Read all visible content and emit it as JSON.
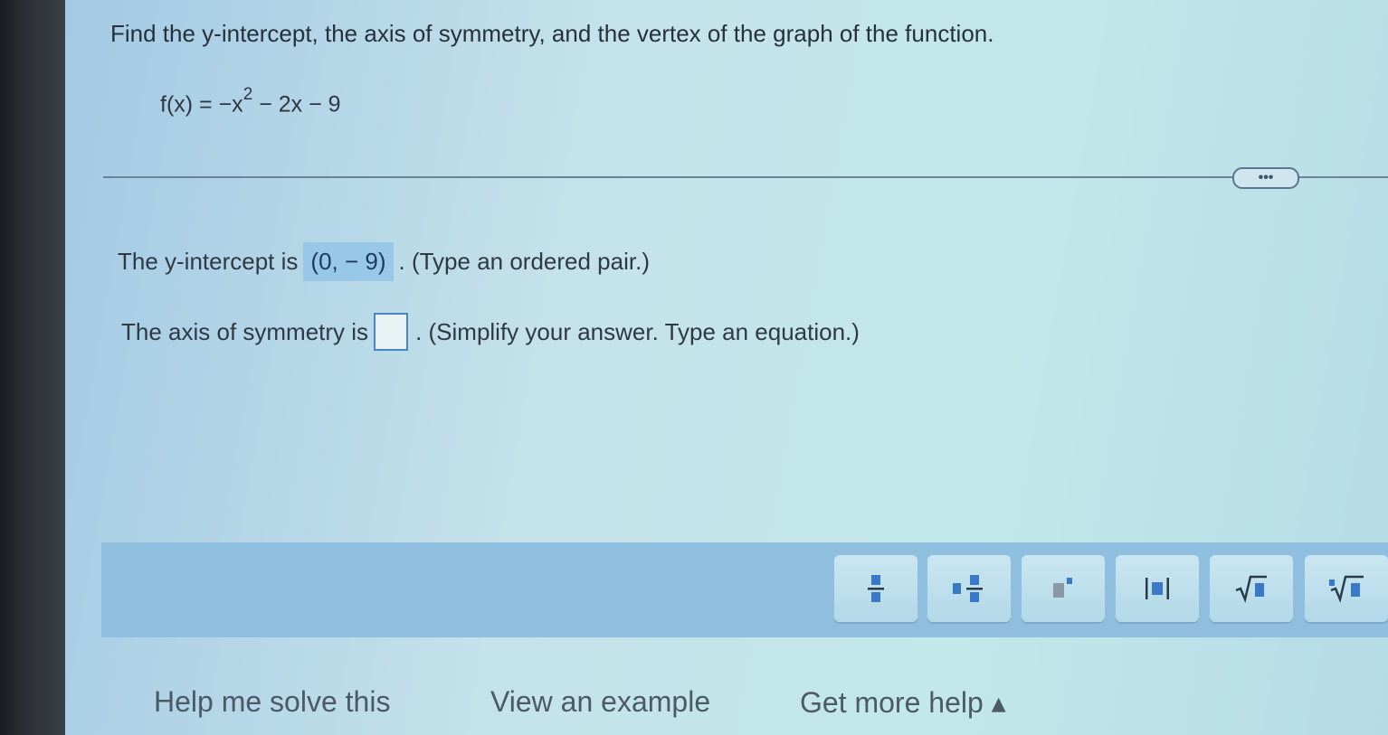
{
  "question": {
    "prompt": "Find the y-intercept, the axis of symmetry, and the vertex of the graph of the function.",
    "function_lhs": "f(x) = −x",
    "function_exp": "2",
    "function_rhs": " − 2x − 9"
  },
  "more_button": {
    "label": "•••"
  },
  "y_intercept": {
    "prefix": "The y-intercept is",
    "answer": "(0, − 9)",
    "suffix": ". (Type an ordered pair.)"
  },
  "axis_symmetry": {
    "prefix": "The axis of symmetry is",
    "value": "",
    "suffix": ". (Simplify your answer. Type an equation.)"
  },
  "toolbar": {
    "tools": [
      "fraction-icon",
      "mixed-number-icon",
      "exponent-icon",
      "absolute-value-icon",
      "square-root-icon",
      "nth-root-icon"
    ]
  },
  "help_links": {
    "solve": "Help me solve this",
    "example": "View an example",
    "more": "Get more help ▴"
  }
}
